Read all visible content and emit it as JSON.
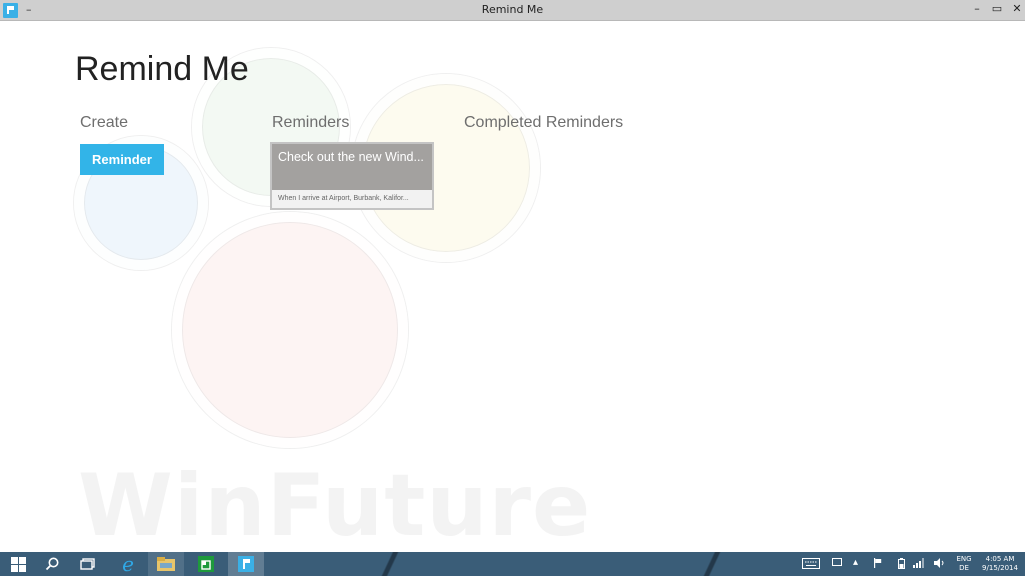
{
  "window": {
    "title": "Remind Me",
    "menu_glyph": "–",
    "controls": {
      "minimize": "–",
      "restore": "▭",
      "close": "✕"
    }
  },
  "page": {
    "title": "Remind Me",
    "sections": {
      "create": "Create",
      "reminders": "Reminders",
      "completed": "Completed Reminders"
    }
  },
  "create": {
    "button_label": "Reminder"
  },
  "reminders": [
    {
      "title": "Check out the new Wind...",
      "trigger": "When I arrive at Airport, Burbank, Kalifor..."
    }
  ],
  "watermark": "WinFuture",
  "taskbar": {
    "pinned": [
      "start-icon",
      "search-icon",
      "task-view-icon",
      "internet-explorer-icon",
      "file-explorer-icon",
      "store-icon",
      "remind-me-icon"
    ],
    "tray": {
      "input_lang": "ENG",
      "input_region": "DE",
      "time": "4:05 AM",
      "date": "9/15/2014"
    }
  },
  "colors": {
    "accent": "#32b4e8",
    "taskbar": "#3a5d78",
    "tile": "#a3a19f"
  }
}
